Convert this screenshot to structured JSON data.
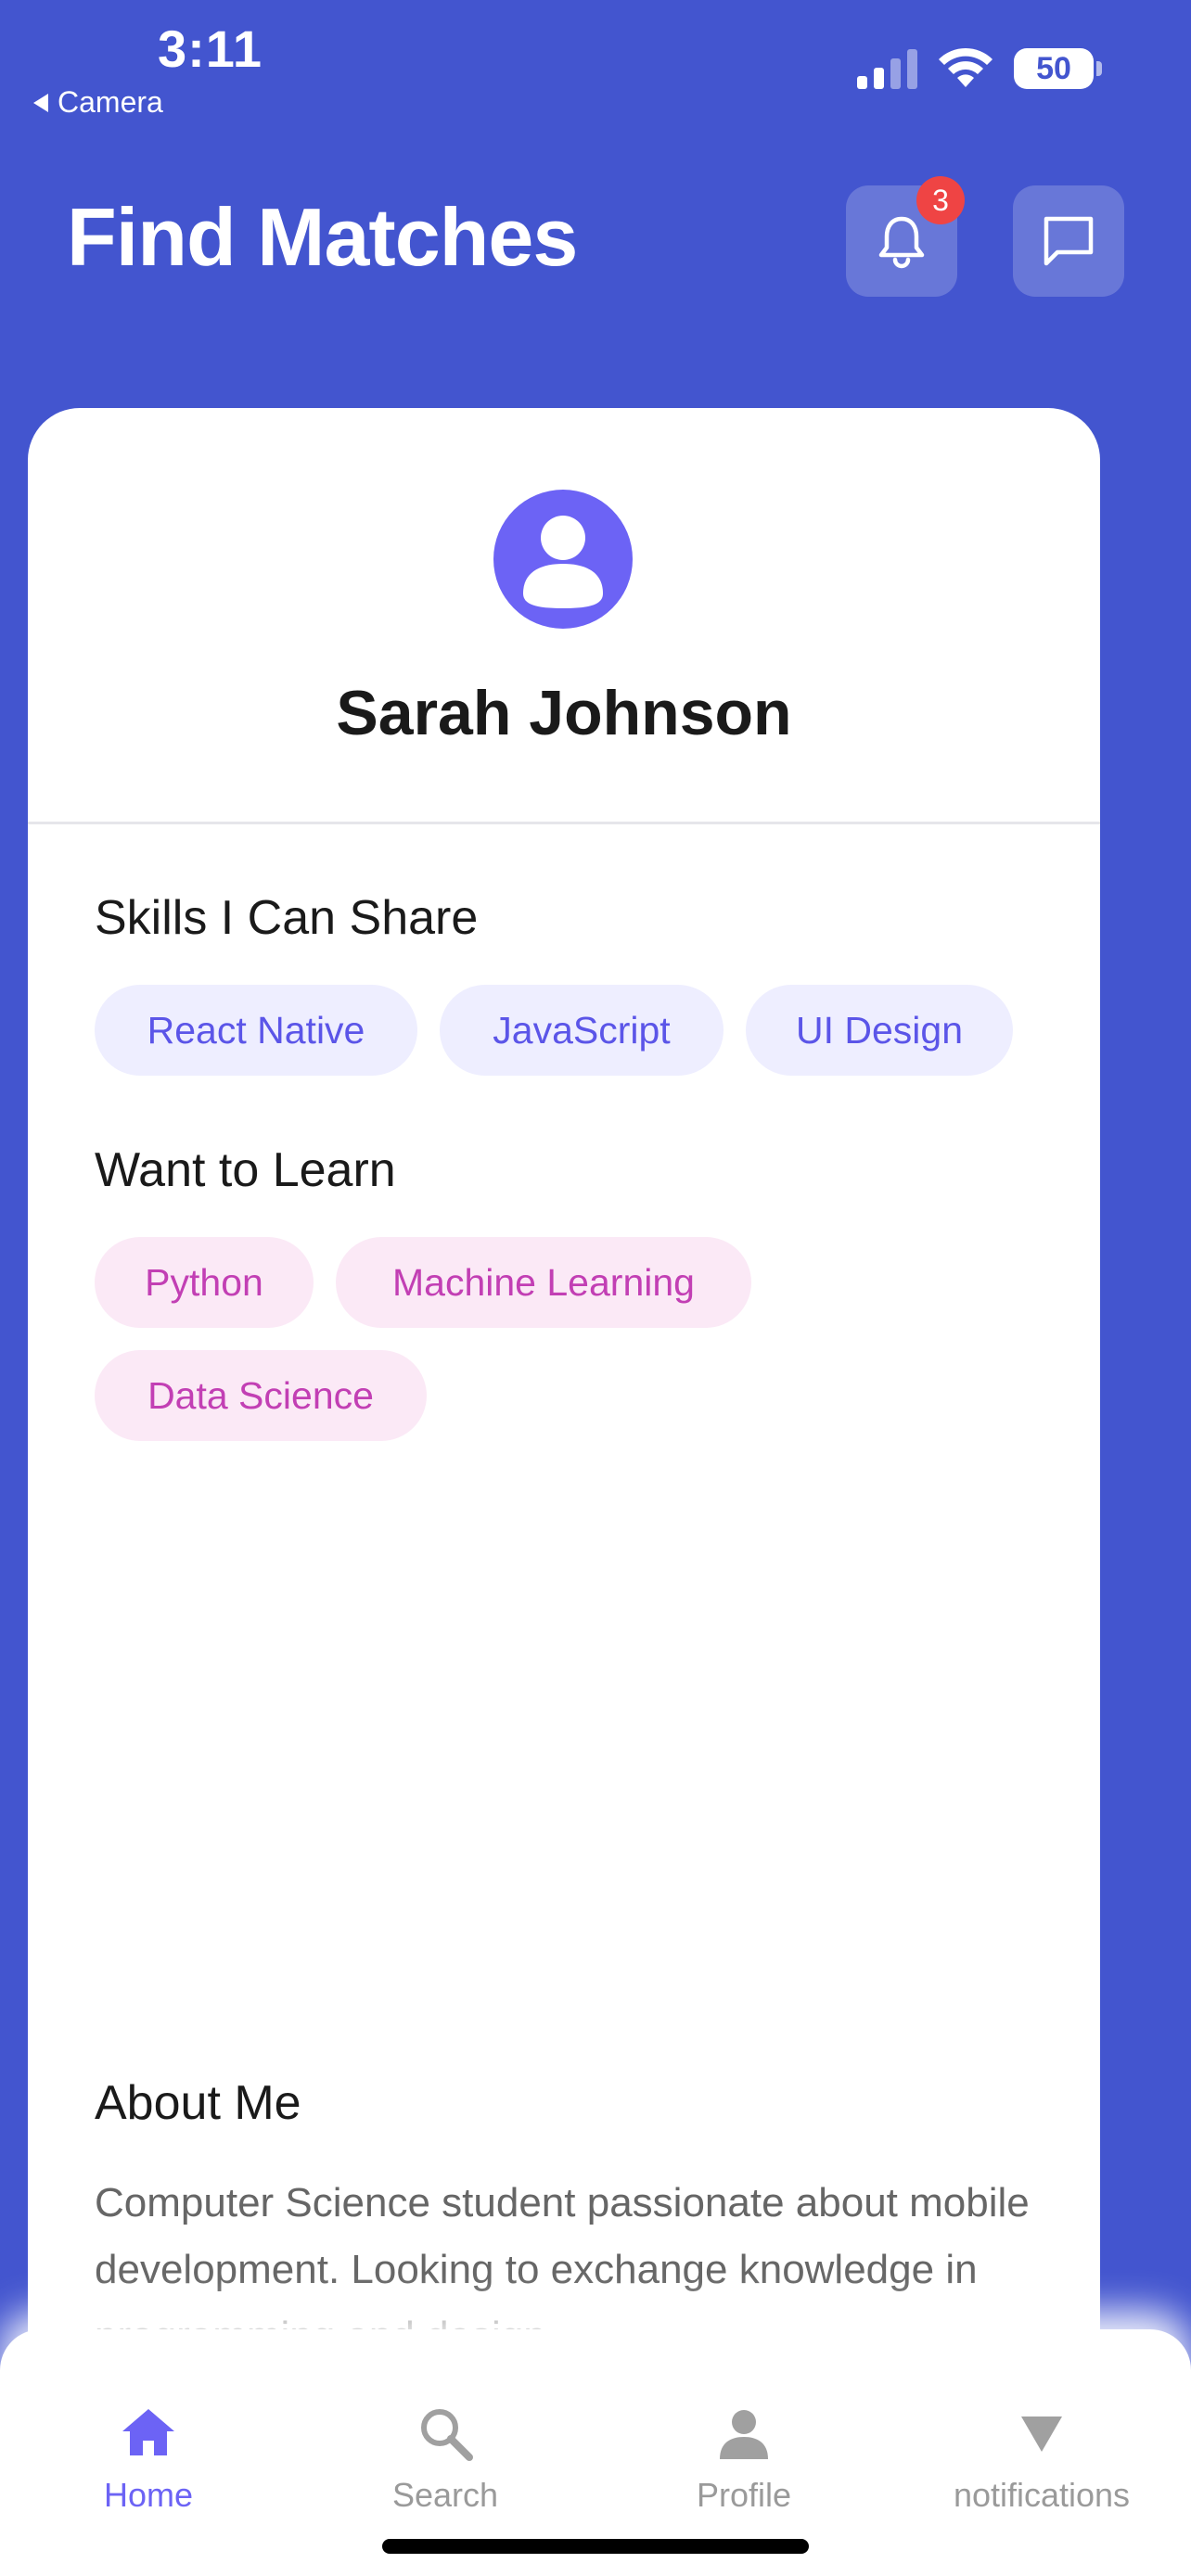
{
  "status_bar": {
    "time": "3:11",
    "back_app": "Camera",
    "battery": "50"
  },
  "header": {
    "title": "Find Matches",
    "notification_count": "3"
  },
  "profile": {
    "name": "Sarah Johnson"
  },
  "skills_share": {
    "heading": "Skills I Can Share",
    "items": [
      "React Native",
      "JavaScript",
      "UI Design"
    ]
  },
  "skills_learn": {
    "heading": "Want to Learn",
    "items": [
      "Python",
      "Machine Learning",
      "Data Science"
    ]
  },
  "about": {
    "heading": "About Me",
    "text": "Computer Science student passionate about mobile development. Looking to exchange knowledge in programming and design."
  },
  "tabs": [
    {
      "label": "Home",
      "icon": "home-icon",
      "active": true
    },
    {
      "label": "Search",
      "icon": "search-icon",
      "active": false
    },
    {
      "label": "Profile",
      "icon": "person-icon",
      "active": false
    },
    {
      "label": "notifications",
      "icon": "triangle-down-icon",
      "active": false
    }
  ],
  "colors": {
    "header_bg": "#4355cf",
    "accent": "#6c63f5",
    "share_chip_bg": "#eeeeff",
    "share_chip_text": "#5b55e8",
    "learn_chip_bg": "#fbe9f6",
    "learn_chip_text": "#c23fb4",
    "badge": "#ef4444"
  }
}
